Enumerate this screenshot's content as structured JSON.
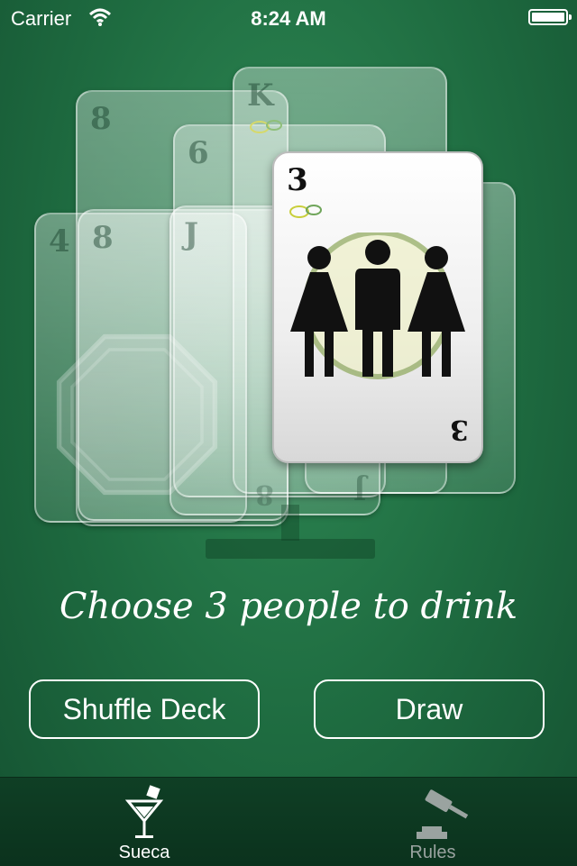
{
  "status_bar": {
    "carrier": "Carrier",
    "time": "8:24 AM",
    "battery_icon": "battery-full-icon",
    "wifi_icon": "wifi-icon"
  },
  "cards": {
    "back_cards": [
      {
        "rank": "8"
      },
      {
        "rank": "6"
      },
      {
        "rank": "K"
      },
      {
        "rank": "4"
      },
      {
        "rank": "8"
      },
      {
        "rank": "J"
      }
    ],
    "front_card": {
      "rank": "3",
      "icon": "three-people-icon"
    },
    "lemon_icon": "lemon-icon",
    "stop_icon": "stop-sign-icon"
  },
  "prompt": "Choose 3 people to drink",
  "buttons": {
    "shuffle_label": "Shuffle Deck",
    "draw_label": "Draw"
  },
  "tab_bar": {
    "tabs": [
      {
        "label": "Sueca",
        "icon": "cocktail-icon",
        "selected": true
      },
      {
        "label": "Rules",
        "icon": "gavel-icon",
        "selected": false
      }
    ]
  },
  "colors": {
    "background": "#1e6b40",
    "tab_bar": "#0f3f25",
    "tab_selected": "#ffffff",
    "tab_unselected": "#9aa3a0"
  }
}
